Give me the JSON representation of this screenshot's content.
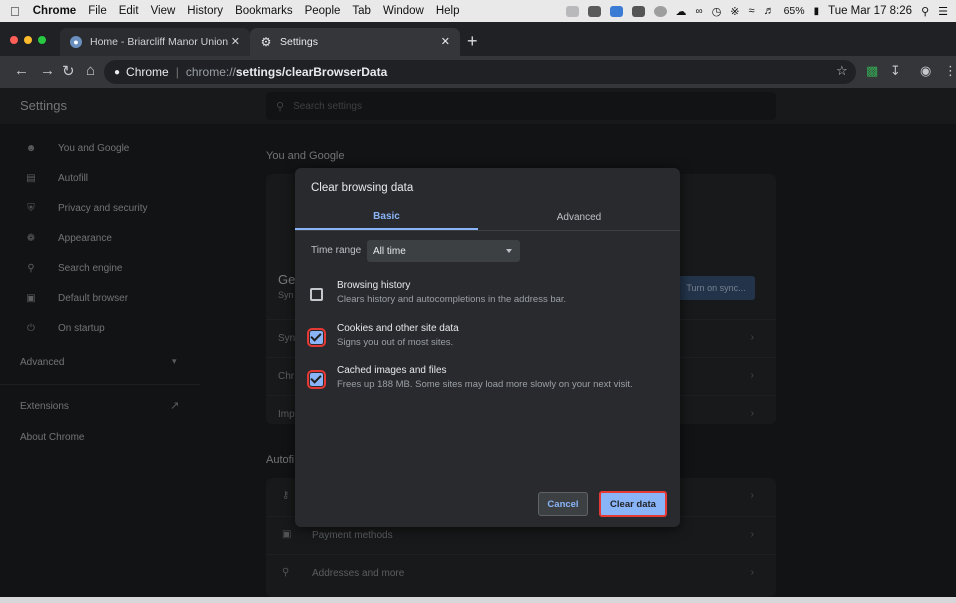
{
  "menubar": {
    "items": [
      "Chrome",
      "File",
      "Edit",
      "View",
      "History",
      "Bookmarks",
      "People",
      "Tab",
      "Window",
      "Help"
    ],
    "battery": "65%",
    "clock": "Tue Mar 17  8:26"
  },
  "tabs": [
    {
      "title": "Home - Briarcliff Manor Union",
      "active": false
    },
    {
      "title": "Settings",
      "active": true
    }
  ],
  "omnibox": {
    "chip": "Chrome",
    "host": "chrome://",
    "path": "settings/clearBrowserData"
  },
  "settings": {
    "title": "Settings",
    "search_placeholder": "Search settings",
    "sidebar": [
      {
        "label": "You and Google",
        "icon": "person-icon"
      },
      {
        "label": "Autofill",
        "icon": "clipboard-icon"
      },
      {
        "label": "Privacy and security",
        "icon": "shield-icon"
      },
      {
        "label": "Appearance",
        "icon": "palette-icon"
      },
      {
        "label": "Search engine",
        "icon": "search-icon"
      },
      {
        "label": "Default browser",
        "icon": "browser-icon"
      },
      {
        "label": "On startup",
        "icon": "power-icon"
      }
    ],
    "advanced": "Advanced",
    "extensions": "Extensions",
    "about": "About Chrome",
    "section_you_google": "You and Google",
    "section_autofill": "Autofi",
    "sync_button": "Turn on sync...",
    "peek_ge": "Ge",
    "peek_syn": "Syn",
    "rows": [
      "Syn",
      "Chr",
      "Imp"
    ],
    "autofill_rows": [
      {
        "label": "Payment methods",
        "icon": "card-icon"
      },
      {
        "label": "Addresses and more",
        "icon": "pin-icon"
      }
    ]
  },
  "dialog": {
    "title": "Clear browsing data",
    "tab_basic": "Basic",
    "tab_advanced": "Advanced",
    "time_range_label": "Time range",
    "time_range_value": "All time",
    "options": [
      {
        "title": "Browsing history",
        "desc": "Clears history and autocompletions in the address bar.",
        "checked": false
      },
      {
        "title": "Cookies and other site data",
        "desc": "Signs you out of most sites.",
        "checked": true
      },
      {
        "title": "Cached images and files",
        "desc": "Frees up 188 MB. Some sites may load more slowly on your next visit.",
        "checked": true
      }
    ],
    "cancel": "Cancel",
    "clear": "Clear data"
  },
  "colors": {
    "accent": "#8ab4f8",
    "highlight": "#e53935",
    "background": "#202124"
  }
}
